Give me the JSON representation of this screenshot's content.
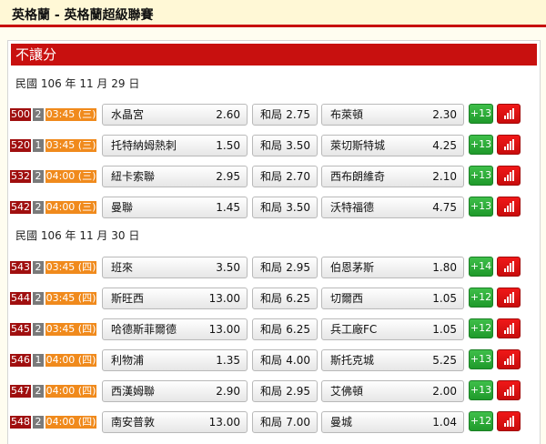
{
  "header": {
    "title": "英格蘭 - 英格蘭超級聯賽"
  },
  "section": {
    "title": "不讓分"
  },
  "colors": {
    "accent_red": "#c8100f",
    "code_badge": "#a00f0f",
    "time_badge": "#f08a1c",
    "more_button": "#1f9a2b"
  },
  "labels": {
    "draw": "和局"
  },
  "groups": [
    {
      "date": "民國 106 年 11 月 29 日",
      "matches": [
        {
          "code": "500",
          "level": "2",
          "time": "03:45 (三)",
          "home": "水晶宮",
          "home_odds": "2.60",
          "draw_odds": "2.75",
          "away": "布萊頓",
          "away_odds": "2.30",
          "more": "+13"
        },
        {
          "code": "520",
          "level": "1",
          "time": "03:45 (三)",
          "home": "托特納姆熱刺",
          "home_odds": "1.50",
          "draw_odds": "3.50",
          "away": "萊切斯特城",
          "away_odds": "4.25",
          "more": "+13"
        },
        {
          "code": "532",
          "level": "2",
          "time": "04:00 (三)",
          "home": "紐卡索聯",
          "home_odds": "2.95",
          "draw_odds": "2.70",
          "away": "西布朗維奇",
          "away_odds": "2.10",
          "more": "+13"
        },
        {
          "code": "542",
          "level": "2",
          "time": "04:00 (三)",
          "home": "曼聯",
          "home_odds": "1.45",
          "draw_odds": "3.50",
          "away": "沃特福德",
          "away_odds": "4.75",
          "more": "+13"
        }
      ]
    },
    {
      "date": "民國 106 年 11 月 30 日",
      "matches": [
        {
          "code": "543",
          "level": "2",
          "time": "03:45 (四)",
          "home": "班來",
          "home_odds": "3.50",
          "draw_odds": "2.95",
          "away": "伯恩茅斯",
          "away_odds": "1.80",
          "more": "+14"
        },
        {
          "code": "544",
          "level": "2",
          "time": "03:45 (四)",
          "home": "斯旺西",
          "home_odds": "13.00",
          "draw_odds": "6.25",
          "away": "切爾西",
          "away_odds": "1.05",
          "more": "+12"
        },
        {
          "code": "545",
          "level": "2",
          "time": "03:45 (四)",
          "home": "哈德斯菲爾德",
          "home_odds": "13.00",
          "draw_odds": "6.25",
          "away": "兵工廠FC",
          "away_odds": "1.05",
          "more": "+12"
        },
        {
          "code": "546",
          "level": "1",
          "time": "04:00 (四)",
          "home": "利物浦",
          "home_odds": "1.35",
          "draw_odds": "4.00",
          "away": "斯托克城",
          "away_odds": "5.25",
          "more": "+13"
        },
        {
          "code": "547",
          "level": "2",
          "time": "04:00 (四)",
          "home": "西漢姆聯",
          "home_odds": "2.90",
          "draw_odds": "2.95",
          "away": "艾佛頓",
          "away_odds": "2.00",
          "more": "+13"
        },
        {
          "code": "548",
          "level": "2",
          "time": "04:00 (四)",
          "home": "南安普敦",
          "home_odds": "13.00",
          "draw_odds": "7.00",
          "away": "曼城",
          "away_odds": "1.04",
          "more": "+12"
        }
      ]
    }
  ]
}
